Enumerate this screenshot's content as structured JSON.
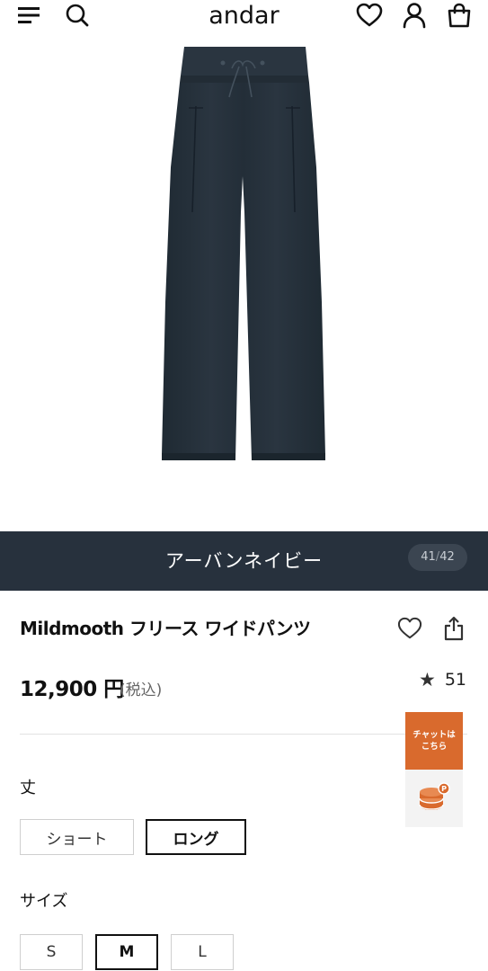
{
  "header": {
    "logo": "andar",
    "icons": [
      "menu-icon",
      "search-icon",
      "heart-icon",
      "account-icon",
      "cart-icon"
    ]
  },
  "gallery": {
    "color_name": "アーバンネイビー",
    "current": "41",
    "separator": "/",
    "total": "42"
  },
  "product": {
    "title": "Mildmooth フリース ワイドパンツ",
    "price": "12,900 円",
    "tax_note": "(税込)",
    "rating": "51"
  },
  "chat": {
    "line1": "チャットは",
    "line2": "こちら"
  },
  "options": {
    "length": {
      "label": "丈",
      "choices": [
        "ショート",
        "ロング"
      ],
      "selected": "ロング"
    },
    "size": {
      "label": "サイズ",
      "choices": [
        "S",
        "M",
        "L"
      ],
      "selected": "M"
    }
  },
  "colors": {
    "accent": "#d96a2d",
    "navy_bar": "#27313d",
    "pants": "#26313b"
  }
}
